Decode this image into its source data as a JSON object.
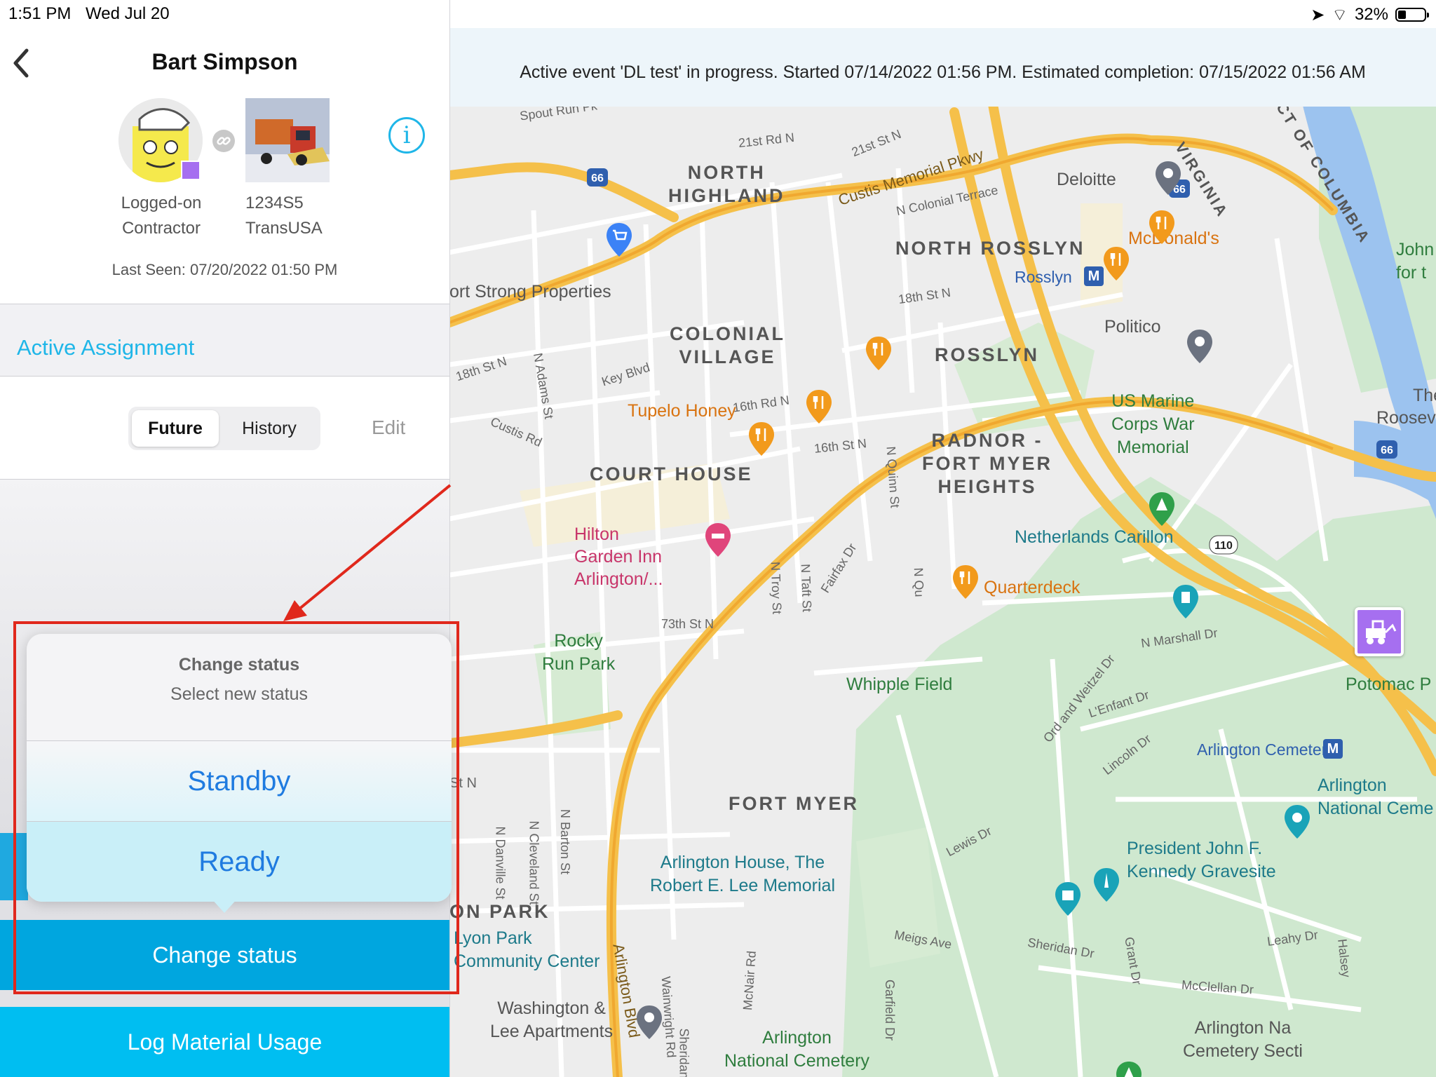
{
  "status_bar": {
    "time": "1:51 PM",
    "date": "Wed Jul 20",
    "battery": "32%"
  },
  "header": {
    "title": "Bart Simpson",
    "back_icon": "chevron-left-icon",
    "info_icon": "info-icon"
  },
  "profile": {
    "user_role_line1": "Logged-on",
    "user_role_line2": "Contractor",
    "vehicle_id": "1234S5",
    "vehicle_company": "TransUSA",
    "status_color": "#a66ff0",
    "last_seen": "Last Seen: 07/20/2022 01:50 PM"
  },
  "assignment": {
    "section_label": "Active Assignment"
  },
  "tabs": {
    "future": "Future",
    "history": "History",
    "edit": "Edit",
    "selected": "Future"
  },
  "popover": {
    "title": "Change status",
    "subtitle": "Select new status",
    "options": [
      "Standby",
      "Ready"
    ]
  },
  "actions": {
    "change_status": "Change status",
    "log_material": "Log Material Usage"
  },
  "banner": {
    "text": "Active event 'DL test' in progress. Started 07/14/2022 01:56 PM. Estimated completion: 07/15/2022 01:56 AM"
  },
  "map": {
    "areas": [
      "NORTH HIGHLAND",
      "NORTH ROSSLYN",
      "COLONIAL VILLAGE",
      "ROSSLYN",
      "COURT HOUSE",
      "RADNOR - FORT MYER HEIGHTS",
      "FORT MYER",
      "ON PARK"
    ],
    "pois": {
      "deloitte": "Deloitte",
      "mcdonalds": "McDonald's",
      "rosslyn_metro": "Rosslyn",
      "politico": "Politico",
      "tupelo": "Tupelo Honey",
      "hilton": "Hilton Garden Inn Arlington/...",
      "quarterdeck": "Quarterdeck",
      "strong": "ort Strong Properties",
      "marine": "US Marine Corps War Memorial",
      "carillon": "Netherlands Carillon",
      "rocky_run": "Rocky Run Park",
      "whipple": "Whipple Field",
      "arl_cemetery_station": "Arlington Cemetery",
      "arl_nat_cem": "Arlington National Ceme",
      "jfk": "President John F. Kennedy Gravesite",
      "arl_house": "Arlington House, The Robert E. Lee Memorial",
      "lyon": "Lyon Park Community Center",
      "washlee": "Washington & Lee Apartments",
      "arl_nat_cemetery": "Arlington National Cemetery",
      "arl_nat_section": "Arlington Na Cemetery Secti",
      "potomac": "Potomac P",
      "roosevelt": "Roosevelt Bri",
      "theo": "Theo",
      "john": "John for t",
      "dc": "CT OF COLUMBIA",
      "virginia": "VIRGINIA"
    },
    "streets": [
      "Spout Run Pk",
      "21st Rd N",
      "21st St N",
      "Custis Memorial Pkwy",
      "N Colonial Terrace",
      "18th St N",
      "18th St N",
      "N Adams St",
      "Key Blvd",
      "Custis Rd",
      "16th Rd N",
      "16th St N",
      "N Quinn St",
      "Fairfax Dr",
      "N Troy St",
      "N Taft St",
      "73th St N",
      "N Qu",
      "N Marshall Dr",
      "Ord and Weitzel Dr",
      "L'Enfant Dr",
      "Lincoln Dr",
      "Lewis Dr",
      "St N",
      "N Danville St",
      "N Cleveland St",
      "N Barton St",
      "Arlington Blvd",
      "Wainwright Rd",
      "McNair Rd",
      "Garfield Dr",
      "Sheridan A",
      "Meigs Ave",
      "Sheridan Dr",
      "Grant Dr",
      "McClellan Dr",
      "Leahy Dr",
      "Halsey",
      "66",
      "110"
    ]
  }
}
